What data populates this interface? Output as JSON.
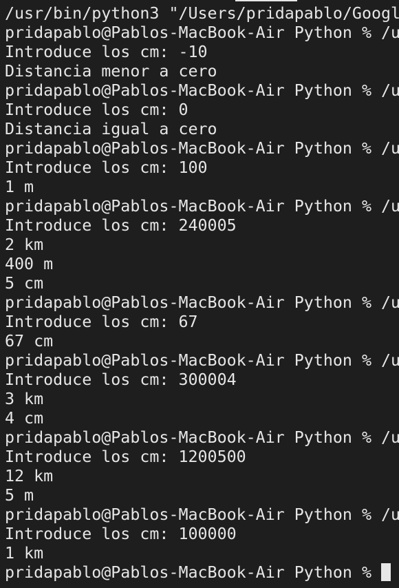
{
  "terminal": {
    "lines": [
      "/usr/bin/python3 \"/Users/pridapablo/Googl",
      "pridapablo@Pablos-MacBook-Air Python % /u",
      "Introduce los cm: -10",
      "Distancia menor a cero",
      "pridapablo@Pablos-MacBook-Air Python % /u",
      "Introduce los cm: 0",
      "Distancia igual a cero",
      "pridapablo@Pablos-MacBook-Air Python % /u",
      "Introduce los cm: 100",
      "1 m",
      "pridapablo@Pablos-MacBook-Air Python % /u",
      "Introduce los cm: 240005",
      "2 km",
      "400 m",
      "5 cm",
      "pridapablo@Pablos-MacBook-Air Python % /u",
      "Introduce los cm: 67",
      "67 cm",
      "pridapablo@Pablos-MacBook-Air Python % /u",
      "Introduce los cm: 300004",
      "3 km",
      "4 cm",
      "pridapablo@Pablos-MacBook-Air Python % /u",
      "Introduce los cm: 1200500",
      "12 km",
      "5 m",
      "pridapablo@Pablos-MacBook-Air Python % /u",
      "Introduce los cm: 100000",
      "1 km"
    ],
    "prompt": "pridapablo@Pablos-MacBook-Air Python % ",
    "colors": {
      "background": "#1e1e1e",
      "foreground": "#e6e6e6"
    }
  }
}
